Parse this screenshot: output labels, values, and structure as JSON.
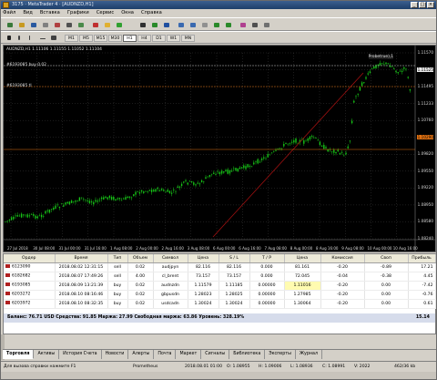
{
  "window": {
    "title": "3175 · MetaTrader 4 · [AUDNZD,H1]",
    "controls": [
      "_",
      "□",
      "×"
    ]
  },
  "menu": [
    "Файл",
    "Вид",
    "Вставка",
    "Графики",
    "Сервис",
    "Окна",
    "Справка"
  ],
  "timeframes": [
    "M1",
    "M5",
    "M15",
    "M30",
    "H1",
    "H4",
    "D1",
    "W1",
    "MN"
  ],
  "selected_timeframe": "H1",
  "chart": {
    "symbol_label": "AUDNZD,H1 1.11106 1.11155 1.11052 1.11104",
    "buy_label": "#6193085 buy 0.02",
    "sell_label": "#6193085 tl",
    "probe_label": "Probetrue),1",
    "price_ticks": [
      "1.11570",
      "1.11525",
      "1.11495",
      "1.11233",
      "1.10760",
      "1.10290",
      "1.09820",
      "1.09550",
      "1.09220",
      "1.08950",
      "1.08580",
      "1.08240"
    ],
    "time_ticks": [
      "27 Jul 2018",
      "30 Jul 08:00",
      "31 Jul 00:00",
      "31 Jul 16:00",
      "1 Aug 08:00",
      "2 Aug 00:00",
      "2 Aug 16:00",
      "3 Aug 08:00",
      "6 Aug 00:00",
      "6 Aug 16:00",
      "7 Aug 08:00",
      "8 Aug 00:00",
      "8 Aug 16:00",
      "9 Aug 08:00",
      "10 Aug 00:00",
      "10 Aug 16:00"
    ]
  },
  "trades": {
    "headers": [
      "Ордер",
      "Время",
      "Тип",
      "Объем",
      "Символ",
      "Цена",
      "S / L",
      "T / P",
      "Цена",
      "Комиссия",
      "Своп",
      "Прибыль"
    ],
    "rows": [
      [
        "6123090",
        "2018.08.02 12:31:15",
        "sell",
        "0.02",
        "audjpyn",
        "82.116",
        "82.116",
        "0.000",
        "81.161",
        "-0.20",
        "-0.89",
        "17.21"
      ],
      [
        "6182682",
        "2018.08.07 17:49:26",
        "sell",
        "4.00",
        "cl_brent",
        "73.157",
        "73.157",
        "0.000",
        "72.045",
        "-0.04",
        "-0.38",
        "4.45"
      ],
      [
        "6193085",
        "2018.08.09 13:21:39",
        "buy",
        "0.02",
        "audnzdn",
        "1.11579",
        "1.11185",
        "0.00000",
        "1.11016",
        "-0.20",
        "0.00",
        "-7.42"
      ],
      [
        "6203272",
        "2018.08.10 08:16:46",
        "buy",
        "0.02",
        "gbpusdn",
        "1.28023",
        "1.28025",
        "0.00000",
        "1.27985",
        "-0.20",
        "0.00",
        "-0.76"
      ],
      [
        "6203972",
        "2018.08.10 08:32:35",
        "buy",
        "0.02",
        "usdcadn",
        "1.30024",
        "1.30024",
        "0.00000",
        "1.30064",
        "-0.20",
        "0.00",
        "0.61"
      ]
    ],
    "balance_text": "Баланс: 76.71 USD  Средства: 91.85  Маржа: 27.99  Свободная маржа: 63.86  Уровень: 328.19%",
    "balance_profit": "15.14"
  },
  "tabs": [
    "Торговля",
    "Активы",
    "История Счета",
    "Новости",
    "Алерты",
    "Почта",
    "Маркет",
    "Сигналы",
    "Библиотека",
    "Эксперты",
    "Журнал"
  ],
  "active_tab": "Торговля",
  "status": {
    "help": "Для вызова справки нажмите F1",
    "profile": "Prometheus",
    "datetime": "2018.08.01 01:00",
    "open": "O: 1.08955",
    "high": "H: 1.09006",
    "low": "L: 1.08936",
    "close": "C: 1.08991",
    "volume": "V: 2022",
    "traffic": "462/36 kb"
  },
  "colors": {
    "chart_bg": "#000000",
    "candle": "#17c517",
    "grid_line": "#3a3a3a",
    "buy_line": "#d0d0d0",
    "sell_line": "#e07010",
    "trend_line": "#a01010"
  }
}
